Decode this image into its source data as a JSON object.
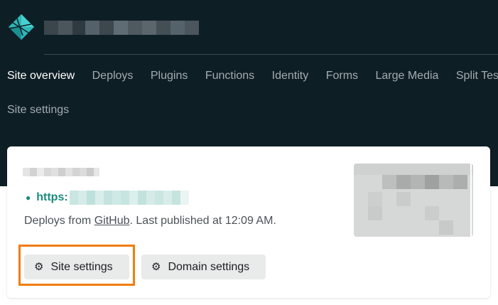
{
  "header": {
    "logo_icon": "netlify-logo-icon",
    "accent_color": "#30c8c9"
  },
  "nav": {
    "items": [
      {
        "label": "Site overview",
        "active": true
      },
      {
        "label": "Deploys"
      },
      {
        "label": "Plugins"
      },
      {
        "label": "Functions"
      },
      {
        "label": "Identity"
      },
      {
        "label": "Forms"
      },
      {
        "label": "Large Media"
      },
      {
        "label": "Split Testing"
      }
    ],
    "second_row": {
      "label": "Site settings"
    }
  },
  "card": {
    "url_prefix": "https:",
    "deploy_prefix": "Deploys from ",
    "deploy_source": "GitHub",
    "deploy_suffix": ". Last published at 12:09 AM.",
    "buttons": {
      "site_settings": "Site settings",
      "domain_settings": "Domain settings"
    },
    "gear_icon": "gear-icon",
    "highlight_color": "#f07d0f"
  }
}
